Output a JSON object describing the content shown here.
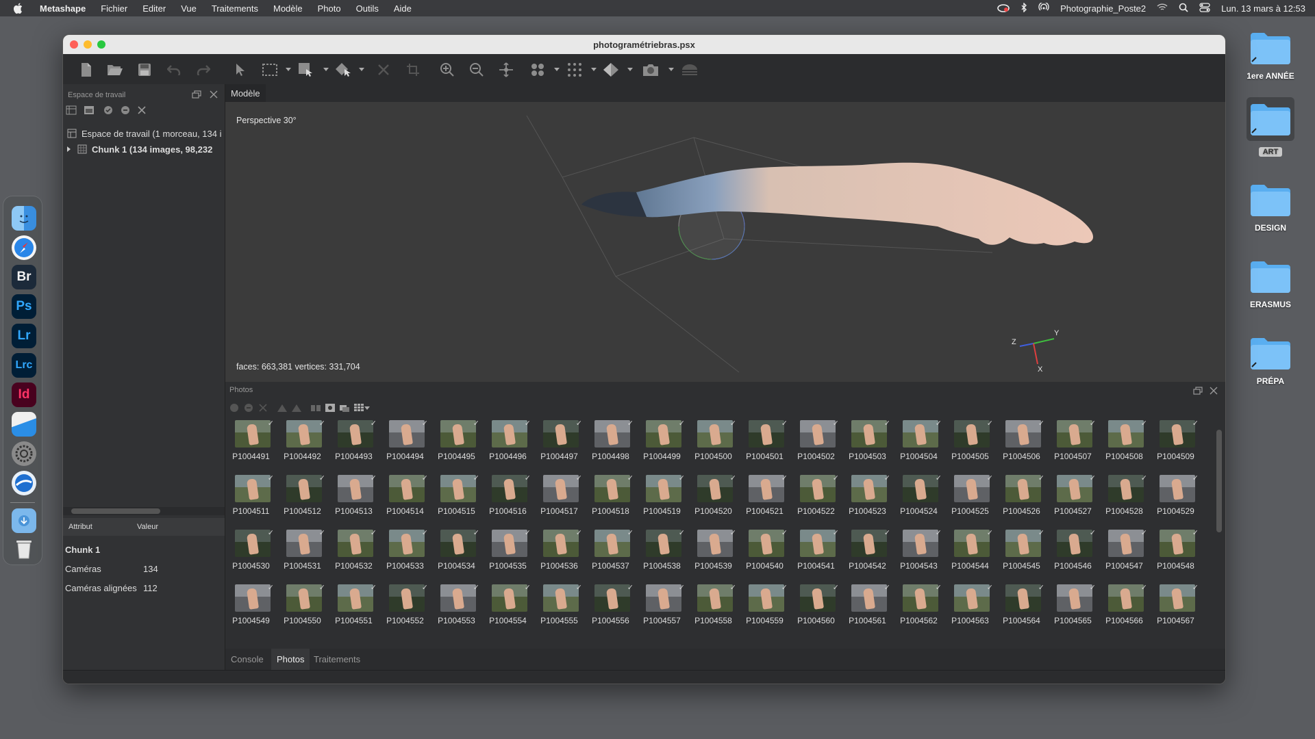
{
  "menubar": {
    "app": "Metashape",
    "items": [
      "Fichier",
      "Editer",
      "Vue",
      "Traitements",
      "Modèle",
      "Photo",
      "Outils",
      "Aide"
    ],
    "station": "Photographie_Poste2",
    "clock": "Lun. 13 mars à 12:53"
  },
  "dock": {
    "apps": [
      {
        "name": "Finder",
        "icon": "finder-icon"
      },
      {
        "name": "Safari",
        "icon": "safari-icon"
      },
      {
        "name": "Br",
        "icon": "bridge-icon",
        "color": "#1c2a3a",
        "fg": "#f2f2f2"
      },
      {
        "name": "Ps",
        "icon": "photoshop-icon",
        "color": "#001e36",
        "fg": "#31a8ff"
      },
      {
        "name": "Lr",
        "icon": "lightroom-icon",
        "color": "#001e36",
        "fg": "#31a8ff"
      },
      {
        "name": "Lrc",
        "icon": "lightroom-classic-icon",
        "color": "#001e36",
        "fg": "#31a8ff"
      },
      {
        "name": "Id",
        "icon": "indesign-icon",
        "color": "#49021f",
        "fg": "#ff3366"
      },
      {
        "name": "Metashape",
        "icon": "metashape-icon"
      },
      {
        "name": "Préférences",
        "icon": "system-preferences-icon"
      },
      {
        "name": "Navigateur",
        "icon": "browser-icon"
      },
      {
        "name": "Téléchargements",
        "icon": "downloads-folder-icon"
      },
      {
        "name": "Corbeille",
        "icon": "trash-icon"
      }
    ]
  },
  "desktop": {
    "folders": [
      {
        "label": "1ere ANNÉE"
      },
      {
        "label": "ART"
      },
      {
        "label": "DESIGN"
      },
      {
        "label": "ERASMUS"
      },
      {
        "label": "PRÉPA"
      }
    ]
  },
  "window": {
    "title": "photogramétriebras.psx"
  },
  "workspace": {
    "title": "Espace de travail",
    "root": "Espace de travail (1 morceau, 134 i",
    "chunk": "Chunk 1 (134 images, 98,232"
  },
  "attributes": {
    "col_attr": "Attribut",
    "col_val": "Valeur",
    "group": "Chunk 1",
    "rows": [
      {
        "attr": "Caméras",
        "value": "134"
      },
      {
        "attr": "Caméras alignées",
        "value": "112"
      }
    ]
  },
  "model": {
    "tab": "Modèle",
    "perspective": "Perspective 30°",
    "stats": "faces: 663,381 vertices: 331,704",
    "axes": {
      "x": "X",
      "y": "Y",
      "z": "Z"
    }
  },
  "photos": {
    "title": "Photos",
    "rows": [
      [
        "P1004491",
        "P1004492",
        "P1004493",
        "P1004494",
        "P1004495",
        "P1004496",
        "P1004497",
        "P1004498",
        "P1004499",
        "P1004500",
        "P1004501",
        "P1004502",
        "P1004503",
        "P1004504",
        "P1004505",
        "P1004506",
        "P1004507",
        "P1004508",
        "P1004509"
      ],
      [
        "P1004511",
        "P1004512",
        "P1004513",
        "P1004514",
        "P1004515",
        "P1004516",
        "P1004517",
        "P1004518",
        "P1004519",
        "P1004520",
        "P1004521",
        "P1004522",
        "P1004523",
        "P1004524",
        "P1004525",
        "P1004526",
        "P1004527",
        "P1004528",
        "P1004529"
      ],
      [
        "P1004530",
        "P1004531",
        "P1004532",
        "P1004533",
        "P1004534",
        "P1004535",
        "P1004536",
        "P1004537",
        "P1004538",
        "P1004539",
        "P1004540",
        "P1004541",
        "P1004542",
        "P1004543",
        "P1004544",
        "P1004545",
        "P1004546",
        "P1004547",
        "P1004548"
      ],
      [
        "P1004549",
        "P1004550",
        "P1004551",
        "P1004552",
        "P1004553",
        "P1004554",
        "P1004555",
        "P1004556",
        "P1004557",
        "P1004558",
        "P1004559",
        "P1004560",
        "P1004561",
        "P1004562",
        "P1004563",
        "P1004564",
        "P1004565",
        "P1004566",
        "P1004567"
      ]
    ]
  },
  "bottom_tabs": [
    "Console",
    "Photos",
    "Traitements"
  ],
  "bottom_tab_active": "Photos"
}
